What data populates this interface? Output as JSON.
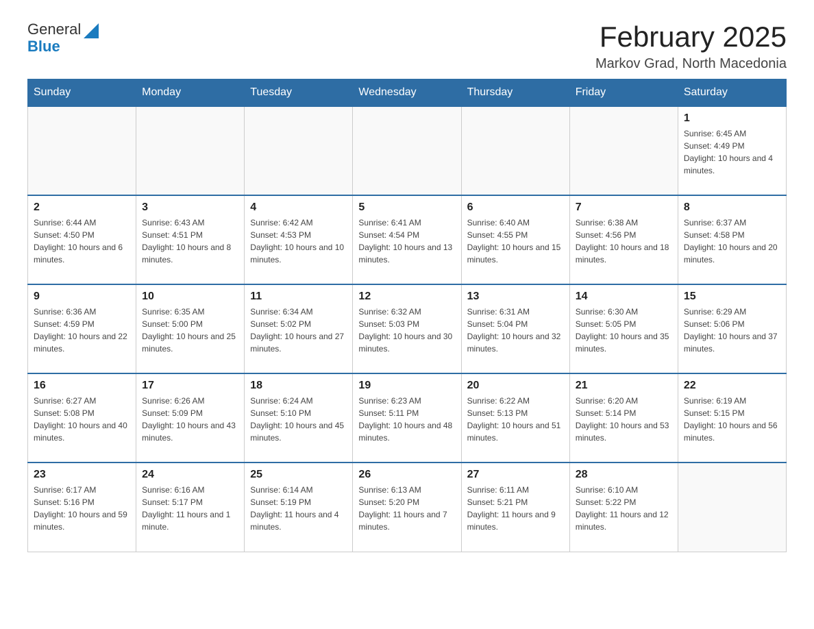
{
  "header": {
    "logo": {
      "text1": "General",
      "text2": "Blue"
    },
    "month": "February 2025",
    "location": "Markov Grad, North Macedonia"
  },
  "days_of_week": [
    "Sunday",
    "Monday",
    "Tuesday",
    "Wednesday",
    "Thursday",
    "Friday",
    "Saturday"
  ],
  "weeks": [
    [
      {
        "day": "",
        "info": ""
      },
      {
        "day": "",
        "info": ""
      },
      {
        "day": "",
        "info": ""
      },
      {
        "day": "",
        "info": ""
      },
      {
        "day": "",
        "info": ""
      },
      {
        "day": "",
        "info": ""
      },
      {
        "day": "1",
        "info": "Sunrise: 6:45 AM\nSunset: 4:49 PM\nDaylight: 10 hours and 4 minutes."
      }
    ],
    [
      {
        "day": "2",
        "info": "Sunrise: 6:44 AM\nSunset: 4:50 PM\nDaylight: 10 hours and 6 minutes."
      },
      {
        "day": "3",
        "info": "Sunrise: 6:43 AM\nSunset: 4:51 PM\nDaylight: 10 hours and 8 minutes."
      },
      {
        "day": "4",
        "info": "Sunrise: 6:42 AM\nSunset: 4:53 PM\nDaylight: 10 hours and 10 minutes."
      },
      {
        "day": "5",
        "info": "Sunrise: 6:41 AM\nSunset: 4:54 PM\nDaylight: 10 hours and 13 minutes."
      },
      {
        "day": "6",
        "info": "Sunrise: 6:40 AM\nSunset: 4:55 PM\nDaylight: 10 hours and 15 minutes."
      },
      {
        "day": "7",
        "info": "Sunrise: 6:38 AM\nSunset: 4:56 PM\nDaylight: 10 hours and 18 minutes."
      },
      {
        "day": "8",
        "info": "Sunrise: 6:37 AM\nSunset: 4:58 PM\nDaylight: 10 hours and 20 minutes."
      }
    ],
    [
      {
        "day": "9",
        "info": "Sunrise: 6:36 AM\nSunset: 4:59 PM\nDaylight: 10 hours and 22 minutes."
      },
      {
        "day": "10",
        "info": "Sunrise: 6:35 AM\nSunset: 5:00 PM\nDaylight: 10 hours and 25 minutes."
      },
      {
        "day": "11",
        "info": "Sunrise: 6:34 AM\nSunset: 5:02 PM\nDaylight: 10 hours and 27 minutes."
      },
      {
        "day": "12",
        "info": "Sunrise: 6:32 AM\nSunset: 5:03 PM\nDaylight: 10 hours and 30 minutes."
      },
      {
        "day": "13",
        "info": "Sunrise: 6:31 AM\nSunset: 5:04 PM\nDaylight: 10 hours and 32 minutes."
      },
      {
        "day": "14",
        "info": "Sunrise: 6:30 AM\nSunset: 5:05 PM\nDaylight: 10 hours and 35 minutes."
      },
      {
        "day": "15",
        "info": "Sunrise: 6:29 AM\nSunset: 5:06 PM\nDaylight: 10 hours and 37 minutes."
      }
    ],
    [
      {
        "day": "16",
        "info": "Sunrise: 6:27 AM\nSunset: 5:08 PM\nDaylight: 10 hours and 40 minutes."
      },
      {
        "day": "17",
        "info": "Sunrise: 6:26 AM\nSunset: 5:09 PM\nDaylight: 10 hours and 43 minutes."
      },
      {
        "day": "18",
        "info": "Sunrise: 6:24 AM\nSunset: 5:10 PM\nDaylight: 10 hours and 45 minutes."
      },
      {
        "day": "19",
        "info": "Sunrise: 6:23 AM\nSunset: 5:11 PM\nDaylight: 10 hours and 48 minutes."
      },
      {
        "day": "20",
        "info": "Sunrise: 6:22 AM\nSunset: 5:13 PM\nDaylight: 10 hours and 51 minutes."
      },
      {
        "day": "21",
        "info": "Sunrise: 6:20 AM\nSunset: 5:14 PM\nDaylight: 10 hours and 53 minutes."
      },
      {
        "day": "22",
        "info": "Sunrise: 6:19 AM\nSunset: 5:15 PM\nDaylight: 10 hours and 56 minutes."
      }
    ],
    [
      {
        "day": "23",
        "info": "Sunrise: 6:17 AM\nSunset: 5:16 PM\nDaylight: 10 hours and 59 minutes."
      },
      {
        "day": "24",
        "info": "Sunrise: 6:16 AM\nSunset: 5:17 PM\nDaylight: 11 hours and 1 minute."
      },
      {
        "day": "25",
        "info": "Sunrise: 6:14 AM\nSunset: 5:19 PM\nDaylight: 11 hours and 4 minutes."
      },
      {
        "day": "26",
        "info": "Sunrise: 6:13 AM\nSunset: 5:20 PM\nDaylight: 11 hours and 7 minutes."
      },
      {
        "day": "27",
        "info": "Sunrise: 6:11 AM\nSunset: 5:21 PM\nDaylight: 11 hours and 9 minutes."
      },
      {
        "day": "28",
        "info": "Sunrise: 6:10 AM\nSunset: 5:22 PM\nDaylight: 11 hours and 12 minutes."
      },
      {
        "day": "",
        "info": ""
      }
    ]
  ]
}
